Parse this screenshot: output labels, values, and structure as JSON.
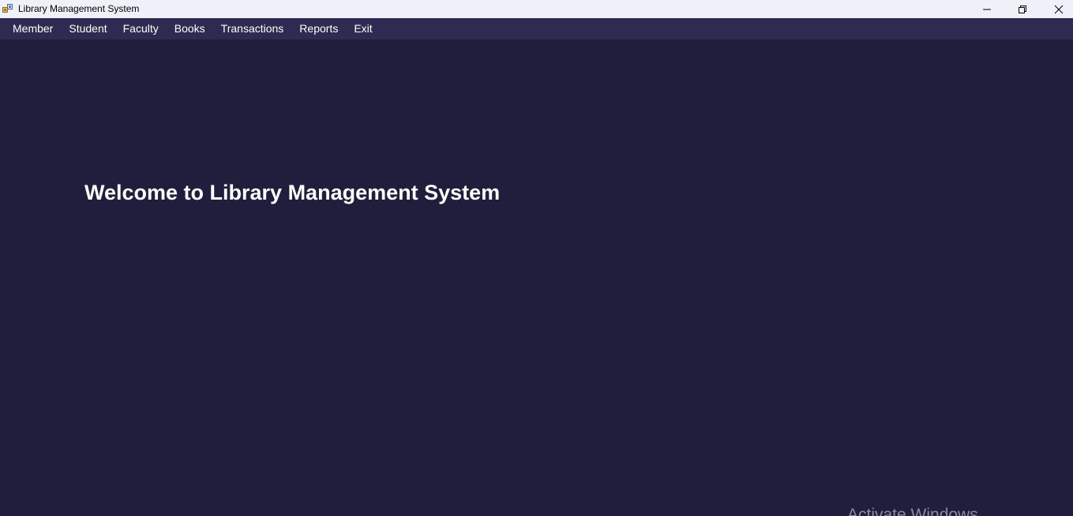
{
  "window": {
    "title": "Library Management System",
    "icon": "app-icon",
    "controls": {
      "minimize_icon": "minimize-icon",
      "maximize_icon": "restore-icon",
      "close_icon": "close-icon"
    }
  },
  "menu": {
    "items": [
      {
        "label": "Member"
      },
      {
        "label": "Student"
      },
      {
        "label": "Faculty"
      },
      {
        "label": "Books"
      },
      {
        "label": "Transactions"
      },
      {
        "label": "Reports"
      },
      {
        "label": "Exit"
      }
    ]
  },
  "main": {
    "welcome_text": "Welcome to Library Management System"
  },
  "watermark": {
    "text": "Activate Windows"
  },
  "colors": {
    "background": "#1f1e3d",
    "menubar": "#2d2b52",
    "titlebar": "#eef1f8",
    "text": "#ffffff"
  }
}
